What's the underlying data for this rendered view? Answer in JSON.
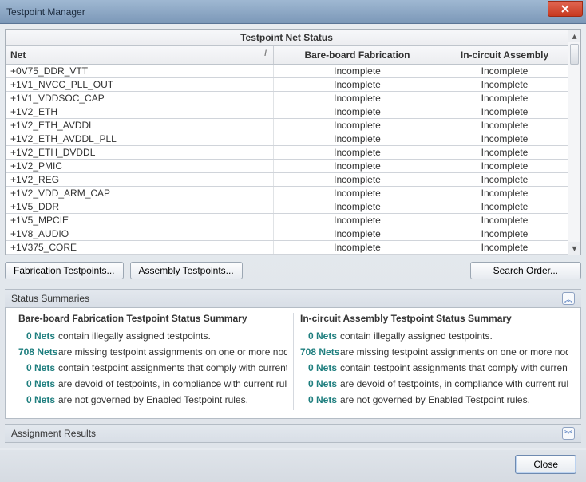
{
  "window": {
    "title": "Testpoint Manager"
  },
  "table": {
    "caption": "Testpoint Net Status",
    "columns": {
      "net": "Net",
      "fab": "Bare-board Fabrication",
      "asm": "In-circuit Assembly"
    },
    "sort_indicator": "/",
    "rows": [
      {
        "net": "+0V75_DDR_VTT",
        "fab": "Incomplete",
        "asm": "Incomplete"
      },
      {
        "net": "+1V1_NVCC_PLL_OUT",
        "fab": "Incomplete",
        "asm": "Incomplete"
      },
      {
        "net": "+1V1_VDDSOC_CAP",
        "fab": "Incomplete",
        "asm": "Incomplete"
      },
      {
        "net": "+1V2_ETH",
        "fab": "Incomplete",
        "asm": "Incomplete"
      },
      {
        "net": "+1V2_ETH_AVDDL",
        "fab": "Incomplete",
        "asm": "Incomplete"
      },
      {
        "net": "+1V2_ETH_AVDDL_PLL",
        "fab": "Incomplete",
        "asm": "Incomplete"
      },
      {
        "net": "+1V2_ETH_DVDDL",
        "fab": "Incomplete",
        "asm": "Incomplete"
      },
      {
        "net": "+1V2_PMIC",
        "fab": "Incomplete",
        "asm": "Incomplete"
      },
      {
        "net": "+1V2_REG",
        "fab": "Incomplete",
        "asm": "Incomplete"
      },
      {
        "net": "+1V2_VDD_ARM_CAP",
        "fab": "Incomplete",
        "asm": "Incomplete"
      },
      {
        "net": "+1V5_DDR",
        "fab": "Incomplete",
        "asm": "Incomplete"
      },
      {
        "net": "+1V5_MPCIE",
        "fab": "Incomplete",
        "asm": "Incomplete"
      },
      {
        "net": "+1V8_AUDIO",
        "fab": "Incomplete",
        "asm": "Incomplete"
      },
      {
        "net": "+1V375_CORE",
        "fab": "Incomplete",
        "asm": "Incomplete"
      }
    ]
  },
  "buttons": {
    "fabrication": "Fabrication Testpoints...",
    "assembly": "Assembly Testpoints...",
    "search_order": "Search Order..."
  },
  "panels": {
    "status_summaries": "Status Summaries",
    "assignment_results": "Assignment Results"
  },
  "summary": {
    "fab_title": "Bare-board Fabrication Testpoint Status Summary",
    "asm_title": "In-circuit Assembly Testpoint Status Summary",
    "lines": [
      {
        "count": "0 Nets",
        "text": "contain illegally assigned testpoints."
      },
      {
        "count": "708 Nets",
        "text": "are missing testpoint assignments on one or more nodes."
      },
      {
        "count": "0 Nets",
        "text": "contain testpoint assignments that comply with current rules."
      },
      {
        "count": "0 Nets",
        "text": "are devoid of testpoints, in compliance with current rules."
      },
      {
        "count": "0 Nets",
        "text": "are not governed by Enabled Testpoint rules."
      }
    ]
  },
  "footer": {
    "close": "Close"
  }
}
